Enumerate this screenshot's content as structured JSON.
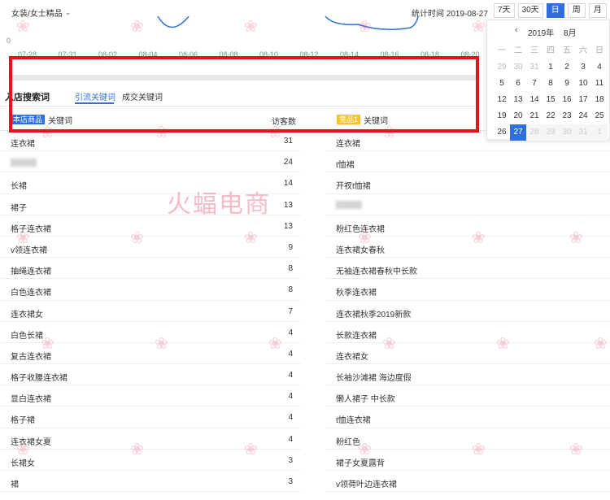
{
  "header": {
    "category": "女装/女士精品",
    "stat_time": "统计时间 2019-08-27",
    "periods": [
      {
        "label": "7天",
        "active": false
      },
      {
        "label": "30天",
        "active": false
      },
      {
        "label": "日",
        "active": true
      },
      {
        "label": "周",
        "active": false
      },
      {
        "label": "月",
        "active": false
      }
    ]
  },
  "chart": {
    "y_zero": "0",
    "x_ticks": [
      "07-28",
      "07-31",
      "08-02",
      "08-04",
      "08-06",
      "08-08",
      "08-10",
      "08-12",
      "08-14",
      "08-16",
      "08-18",
      "08-20"
    ]
  },
  "calendar": {
    "year": "2019年",
    "month": "8月",
    "weekdays": [
      "一",
      "二",
      "三",
      "四",
      "五",
      "六",
      "日"
    ],
    "days": [
      [
        "29",
        "30",
        "31",
        "1",
        "2",
        "3",
        "4"
      ],
      [
        "5",
        "6",
        "7",
        "8",
        "9",
        "10",
        "11"
      ],
      [
        "12",
        "13",
        "14",
        "15",
        "16",
        "17",
        "18"
      ],
      [
        "19",
        "20",
        "21",
        "22",
        "23",
        "24",
        "25"
      ],
      [
        "26",
        "27",
        "28",
        "29",
        "30",
        "31",
        "1"
      ]
    ],
    "selected": "27"
  },
  "section": {
    "title": "入店搜索词",
    "tabs": [
      "引流关键词",
      "成交关键词"
    ],
    "active_tab": 0
  },
  "table_header": {
    "left_badge": "本店商品",
    "left_label": "关键词",
    "visitors_label": "访客数",
    "right_badge": "竞品1",
    "right_label": "关键词"
  },
  "left_rows": [
    {
      "kw": "连衣裙",
      "n": "31"
    },
    {
      "kw": "",
      "n": "24"
    },
    {
      "kw": "长裙",
      "n": "14"
    },
    {
      "kw": "裙子",
      "n": "13"
    },
    {
      "kw": "格子连衣裙",
      "n": "13"
    },
    {
      "kw": "v领连衣裙",
      "n": "9"
    },
    {
      "kw": "抽绳连衣裙",
      "n": "8"
    },
    {
      "kw": "白色连衣裙",
      "n": "8"
    },
    {
      "kw": "连衣裙女",
      "n": "7"
    },
    {
      "kw": "白色长裙",
      "n": "4"
    },
    {
      "kw": "复古连衣裙",
      "n": "4"
    },
    {
      "kw": "格子收腰连衣裙",
      "n": "4"
    },
    {
      "kw": "显白连衣裙",
      "n": "4"
    },
    {
      "kw": "格子裙",
      "n": "4"
    },
    {
      "kw": "连衣裙女夏",
      "n": "4"
    },
    {
      "kw": "长裙女",
      "n": "3"
    },
    {
      "kw": "裙",
      "n": "3"
    }
  ],
  "right_rows": [
    "连衣裙",
    "t恤裙",
    "开衩t恤裙",
    "",
    "粉红色连衣裙",
    "连衣裙女春秋",
    "无袖连衣裙春秋中长款",
    "秋季连衣裙",
    "连衣裙秋季2019新款",
    "长款连衣裙",
    "连衣裙女",
    "长袖沙滩裙 海边度假",
    "懒人裙子 中长款",
    "t恤连衣裙",
    "粉红色",
    "裙子女夏露背",
    "v领荷叶边连衣裙"
  ],
  "watermark": {
    "main": "火蝠电商",
    "small": "火蝠电商"
  },
  "colors": {
    "accent": "#2f6fde",
    "highlight": "#e5141c",
    "competitor_badge": "#f4c430"
  }
}
